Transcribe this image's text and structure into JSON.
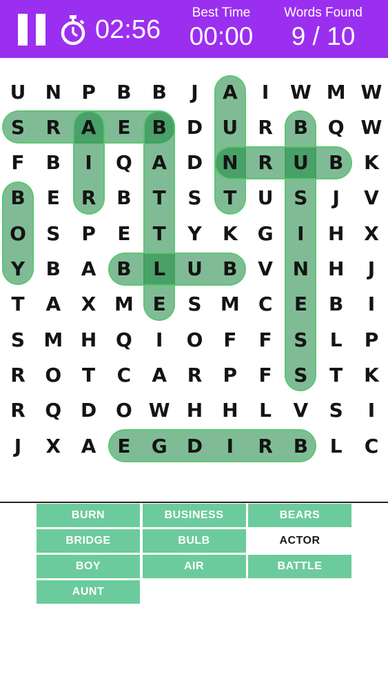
{
  "header": {
    "timer": "02:56",
    "best_time_label": "Best Time",
    "best_time_value": "00:00",
    "words_found_label": "Words Found",
    "words_found_value": "9 / 10",
    "bar_color": "#9b2ff0"
  },
  "grid": [
    [
      "U",
      "N",
      "P",
      "B",
      "B",
      "J",
      "A",
      "I",
      "W",
      "M",
      "W"
    ],
    [
      "S",
      "R",
      "A",
      "E",
      "B",
      "D",
      "U",
      "R",
      "B",
      "Q",
      "W"
    ],
    [
      "F",
      "B",
      "I",
      "Q",
      "A",
      "D",
      "N",
      "R",
      "U",
      "B",
      "K"
    ],
    [
      "B",
      "E",
      "R",
      "B",
      "T",
      "S",
      "T",
      "U",
      "S",
      "J",
      "V"
    ],
    [
      "O",
      "S",
      "P",
      "E",
      "T",
      "Y",
      "K",
      "G",
      "I",
      "H",
      "X"
    ],
    [
      "Y",
      "B",
      "A",
      "B",
      "L",
      "U",
      "B",
      "V",
      "N",
      "H",
      "J"
    ],
    [
      "T",
      "A",
      "X",
      "M",
      "E",
      "S",
      "M",
      "C",
      "E",
      "B",
      "I"
    ],
    [
      "S",
      "M",
      "H",
      "Q",
      "I",
      "O",
      "F",
      "F",
      "S",
      "L",
      "P"
    ],
    [
      "R",
      "O",
      "T",
      "C",
      "A",
      "R",
      "P",
      "F",
      "S",
      "T",
      "K"
    ],
    [
      "R",
      "Q",
      "D",
      "O",
      "W",
      "H",
      "H",
      "L",
      "V",
      "S",
      "I"
    ],
    [
      "J",
      "X",
      "A",
      "E",
      "G",
      "D",
      "I",
      "R",
      "B",
      "L",
      "C"
    ]
  ],
  "found_highlights": [
    {
      "word": "AUNT",
      "r1": 0,
      "c1": 6,
      "r2": 3,
      "c2": 6
    },
    {
      "word": "BEARS",
      "r1": 1,
      "c1": 4,
      "r2": 1,
      "c2": 0
    },
    {
      "word": "AIR",
      "r1": 1,
      "c1": 2,
      "r2": 3,
      "c2": 2
    },
    {
      "word": "BATTLE",
      "r1": 1,
      "c1": 4,
      "r2": 6,
      "c2": 4
    },
    {
      "word": "BUSINESS",
      "r1": 1,
      "c1": 8,
      "r2": 8,
      "c2": 8
    },
    {
      "word": "BURN",
      "r1": 2,
      "c1": 9,
      "r2": 2,
      "c2": 6
    },
    {
      "word": "BOY",
      "r1": 3,
      "c1": 0,
      "r2": 5,
      "c2": 0
    },
    {
      "word": "BULB",
      "r1": 5,
      "c1": 6,
      "r2": 5,
      "c2": 3
    },
    {
      "word": "BRIDGE",
      "r1": 10,
      "c1": 8,
      "r2": 10,
      "c2": 3
    }
  ],
  "word_list": [
    {
      "label": "BURN",
      "found": true
    },
    {
      "label": "BUSINESS",
      "found": true
    },
    {
      "label": "BEARS",
      "found": true
    },
    {
      "label": "BRIDGE",
      "found": true
    },
    {
      "label": "BULB",
      "found": true
    },
    {
      "label": "ACTOR",
      "found": false
    },
    {
      "label": "BOY",
      "found": true
    },
    {
      "label": "AIR",
      "found": true
    },
    {
      "label": "BATTLE",
      "found": true
    },
    {
      "label": "AUNT",
      "found": true
    }
  ],
  "colors": {
    "found_word_bg": "#6ccb9c",
    "highlight": "#228b48"
  }
}
